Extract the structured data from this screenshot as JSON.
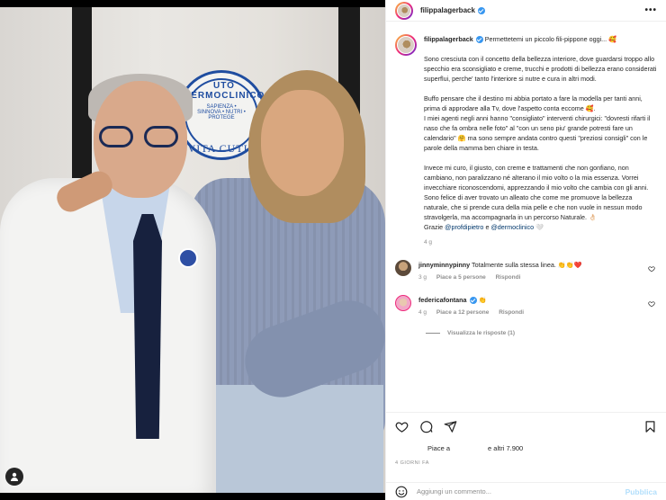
{
  "post": {
    "username": "filippalagerback",
    "more_label": "•••",
    "photo_logo": {
      "top": "UTO DERMOCLINICO",
      "middle": "SAPIENZA • SINNOVA • NUTRI • PROTEGE",
      "bottom": "VITA CUTIS"
    }
  },
  "caption": {
    "username": "filippalagerback",
    "title": "Permettetemi un piccolo fili-pippone oggi... 🥰",
    "p1": "Sono cresciuta con il concetto della bellezza interiore, dove guardarsi troppo allo specchio era sconsigliato e creme, trucchi e prodotti di bellezza erano considerati superflui, perche' tanto l'interiore si nutre e cura in altri modi.",
    "p2a": "Buffo pensare che il destino mi abbia portato a fare la modella per tanti anni, prima di approdare alla Tv, dove l'aspetto conta eccome 🥰.",
    "p2b": "I miei agenti negli anni hanno \"consigliato\" interventi chirurgici: \"dovresti rifarti il naso che fa ombra nelle foto\" al \"con un seno piu' grande potresti fare un calendario\" 🤗 ma sono sempre andata contro questi \"preziosi consigli\" con le parole della mamma ben chiare in testa.",
    "p3": "Invece mi curo, il giusto, con creme e trattamenti che non gonfiano, non cambiano, non paralizzano né alterano il mio volto o la mia essenza. Vorrei invecchiare riconoscendomi, apprezzando il mio volto che cambia con gli anni. Sono felice di aver trovato un alleato che come me promuove la bellezza naturale, che si prende cura della mia pelle e che non vuole in nessun modo stravolgerla, ma accompagnarla in un percorso Naturale. 👌🏻",
    "thanks_prefix": "Grazie",
    "mention1": "@profdipietro",
    "and": "e",
    "mention2": "@dermoclinico",
    "heart": "🤍",
    "age": "4 g"
  },
  "comments": [
    {
      "username": "jinnyminnypinny",
      "text": "Totalmente sulla stessa linea. 👏👏❤️",
      "time": "3 g",
      "likes": "Piace a 5 persone",
      "reply": "Rispondi"
    },
    {
      "username": "federicafontana",
      "text": "👏",
      "time": "4 g",
      "likes": "Piace a 12 persone",
      "reply": "Rispondi",
      "view_replies": "Visualizza le risposte (1)"
    }
  ],
  "likes": {
    "prefix": "Piace a",
    "suffix": "e altri 7.900"
  },
  "timestamp": "4 GIORNI FA",
  "add_comment": {
    "placeholder": "Aggiungi un commento...",
    "post_label": "Pubblica"
  },
  "colors": {
    "accent": "#3897f0",
    "link": "#00376b",
    "muted": "#8e8e8e",
    "post_disabled": "#b2dffc"
  }
}
